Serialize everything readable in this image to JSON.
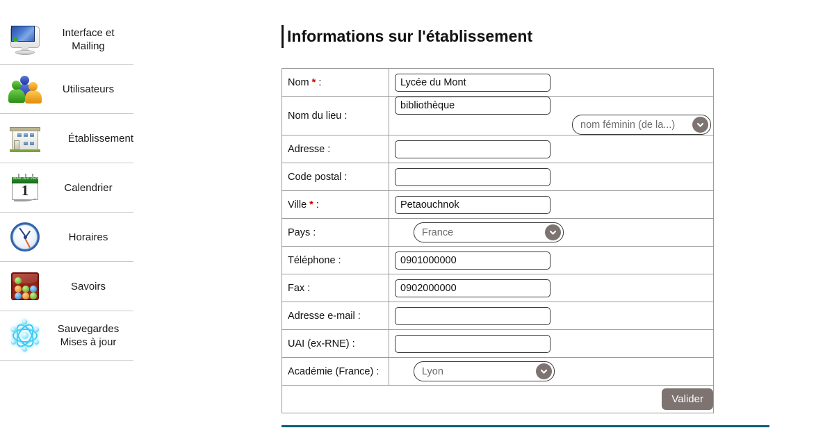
{
  "sidebar": {
    "items": [
      {
        "label": "Interface et\nMailing",
        "icon": "monitor-icon"
      },
      {
        "label": "Utilisateurs",
        "icon": "users-icon"
      },
      {
        "label": "Établissement",
        "icon": "school-building-icon"
      },
      {
        "label": "Calendrier",
        "icon": "calendar-icon",
        "day": "1",
        "months": "MAR  JEU  VEN"
      },
      {
        "label": "Horaires",
        "icon": "clock-icon"
      },
      {
        "label": "Savoirs",
        "icon": "abacus-icon"
      },
      {
        "label": "Sauvegardes\nMises à jour",
        "icon": "atom-icon"
      }
    ]
  },
  "main": {
    "title": "Informations sur l'établissement",
    "required_marker": "*",
    "rows": [
      {
        "label": "Nom",
        "required": true,
        "suffix": " :",
        "value": "Lycée du Mont",
        "type": "text"
      },
      {
        "label": "Nom du lieu :",
        "required": false,
        "value": "bibliothèque",
        "type": "text",
        "select": "nom féminin (de la...)"
      },
      {
        "label": "Adresse :",
        "value": "",
        "type": "text"
      },
      {
        "label": "Code postal :",
        "value": "",
        "type": "text"
      },
      {
        "label": "Ville",
        "required": true,
        "suffix": " :",
        "value": "Petaouchnok",
        "type": "text"
      },
      {
        "label": "Pays :",
        "value": "France",
        "type": "select"
      },
      {
        "label": "Téléphone :",
        "value": "0901000000",
        "type": "text"
      },
      {
        "label": "Fax :",
        "value": "0902000000",
        "type": "text"
      },
      {
        "label": "Adresse e-mail :",
        "value": "",
        "type": "text"
      },
      {
        "label": "UAI (ex-RNE) :",
        "value": "",
        "type": "text"
      },
      {
        "label": "Académie (France) :",
        "value": "Lyon",
        "type": "select"
      }
    ],
    "labels": {
      "nom": "Nom",
      "nom_suffix": " :",
      "nom_du_lieu": "Nom du lieu :",
      "adresse": "Adresse :",
      "code_postal": "Code postal :",
      "ville": "Ville",
      "ville_suffix": " :",
      "pays": "Pays :",
      "telephone": "Téléphone :",
      "fax": "Fax :",
      "email": "Adresse e-mail :",
      "uai": "UAI (ex-RNE) :",
      "academie": "Académie (France) :"
    },
    "values": {
      "nom": "Lycée du Mont",
      "nom_du_lieu": "bibliothèque",
      "genre": "nom féminin (de la...)",
      "adresse": "",
      "code_postal": "",
      "ville": "Petaouchnok",
      "pays": "France",
      "telephone": "0901000000",
      "fax": "0902000000",
      "email": "",
      "uai": "",
      "academie": "Lyon"
    },
    "submit_label": "Valider"
  },
  "colors": {
    "accent_rule": "#0d5b79",
    "required": "#cc0000",
    "button_bg": "#7d7471",
    "text": "#111111"
  }
}
